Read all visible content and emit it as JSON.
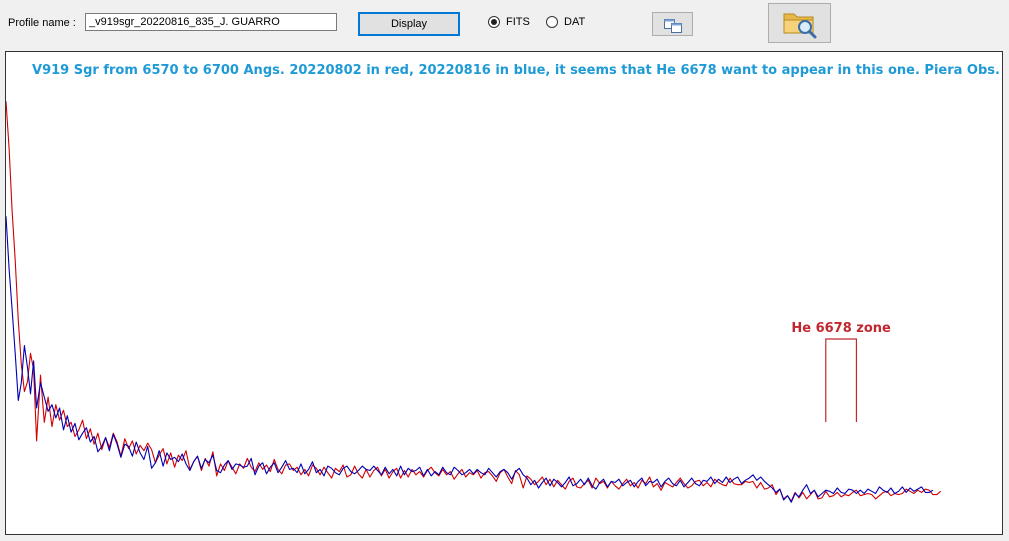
{
  "toolbar": {
    "profile_label": "Profile name :",
    "profile_value": "_v919sgr_20220816_835_J. GUARRO",
    "display_label": "Display",
    "radio_fits": "FITS",
    "radio_dat": "DAT",
    "selected_format": "FITS",
    "copy_icon": "copy-windows-icon",
    "open_icon": "folder-search-icon"
  },
  "colors": {
    "title": "#1e9ad6",
    "annotation": "#c0282e",
    "series_red": "#d10000",
    "series_blue": "#0000b4"
  },
  "chart_data": {
    "type": "line",
    "title": "V919 Sgr from 6570 to 6700 Angs. 20220802 in red, 20220816 in blue, it seems that He 6678 want to appear in this one. Piera Obs.",
    "annotation": {
      "text": "He 6678 zone",
      "x_range": [
        6677,
        6681
      ]
    },
    "xlim": [
      6570,
      6700
    ],
    "ylim": [
      0.6,
      5.0
    ],
    "grid": false,
    "x": [
      6570.0,
      6570.4,
      6570.8,
      6571.2,
      6571.6,
      6572.0,
      6572.4,
      6572.8,
      6573.2,
      6573.6,
      6574.0,
      6574.5,
      6575.0,
      6575.5,
      6576.0,
      6576.5,
      6577.0,
      6577.5,
      6578.0,
      6578.5,
      6579.0,
      6579.5,
      6580.0,
      6580.5,
      6581.0,
      6581.5,
      6582.0,
      6582.5,
      6583.0,
      6583.5,
      6584.0,
      6584.5,
      6585.0,
      6585.5,
      6586.0,
      6586.5,
      6587.0,
      6587.5,
      6588.0,
      6588.5,
      6589.0,
      6589.5,
      6590.0,
      6590.5,
      6591.0,
      6591.5,
      6592.0,
      6592.5,
      6593.0,
      6593.5,
      6594.0,
      6594.5,
      6595.0,
      6595.5,
      6596.0,
      6596.5,
      6597.0,
      6597.5,
      6598.0,
      6598.5,
      6599.0,
      6599.5,
      6600.0,
      6600.5,
      6601.0,
      6601.5,
      6602.0,
      6602.5,
      6603.0,
      6603.5,
      6604.0,
      6604.5,
      6605.0,
      6605.5,
      6606.0,
      6606.5,
      6607.0,
      6607.5,
      6608.0,
      6608.5,
      6609.0,
      6609.5,
      6610.0,
      6610.5,
      6611.0,
      6611.5,
      6612.0,
      6612.5,
      6613.0,
      6613.5,
      6614.0,
      6614.5,
      6615.0,
      6615.5,
      6616.0,
      6616.5,
      6617.0,
      6617.5,
      6618.0,
      6618.5,
      6619.0,
      6619.5,
      6620.0,
      6620.5,
      6621.0,
      6621.5,
      6622.0,
      6622.5,
      6623.0,
      6623.5,
      6624.0,
      6624.5,
      6625.0,
      6625.5,
      6626.0,
      6626.5,
      6627.0,
      6627.5,
      6628.0,
      6628.5,
      6629.0,
      6629.5,
      6630.0,
      6630.5,
      6631.0,
      6631.5,
      6632.0,
      6632.5,
      6633.0,
      6633.5,
      6634.0,
      6634.5,
      6635.0,
      6635.5,
      6636.0,
      6636.5,
      6637.0,
      6637.5,
      6638.0,
      6638.5,
      6639.0,
      6639.5,
      6640.0,
      6640.5,
      6641.0,
      6641.5,
      6642.0,
      6642.5,
      6643.0,
      6643.5,
      6644.0,
      6644.5,
      6645.0,
      6645.5,
      6646.0,
      6646.5,
      6647.0,
      6647.5,
      6648.0,
      6648.5,
      6649.0,
      6649.5,
      6650.0,
      6650.5,
      6651.0,
      6651.5,
      6652.0,
      6652.5,
      6653.0,
      6653.5,
      6654.0,
      6654.5,
      6655.0,
      6655.5,
      6656.0,
      6656.5,
      6657.0,
      6657.5,
      6658.0,
      6658.5,
      6659.0,
      6659.5,
      6660.0,
      6660.5,
      6661.0,
      6661.5,
      6662.0,
      6662.5,
      6663.0,
      6663.5,
      6664.0,
      6664.5,
      6665.0,
      6665.5,
      6666.0,
      6666.5,
      6667.0,
      6667.5,
      6668.0,
      6668.5,
      6669.0,
      6669.5,
      6670.0,
      6670.5,
      6671.0,
      6671.5,
      6672.0,
      6672.5,
      6673.0,
      6673.5,
      6674.0,
      6674.5,
      6675.0,
      6675.5,
      6676.0,
      6676.5,
      6677.0,
      6677.5,
      6678.0,
      6678.5,
      6679.0,
      6679.5,
      6680.0,
      6680.5,
      6681.0,
      6681.5,
      6682.0,
      6682.5,
      6683.0,
      6683.5,
      6684.0,
      6684.5,
      6685.0,
      6685.5,
      6686.0,
      6686.5,
      6687.0,
      6687.5,
      6688.0,
      6688.5,
      6689.0,
      6689.5,
      6690.0,
      6690.5,
      6691.0,
      6691.5,
      6692.0,
      6692.5,
      6693.0,
      6693.5,
      6694.0,
      6694.5,
      6695.0,
      6695.5,
      6696.0,
      6696.5,
      6697.0,
      6697.5,
      6698.0,
      6698.5,
      6699.0,
      6699.5,
      6700.0
    ],
    "series": [
      {
        "color": "red",
        "values": [
          4.55,
          4.12,
          3.55,
          3.1,
          2.55,
          2.15,
          1.9,
          1.99,
          2.25,
          2.1,
          1.45,
          2.05,
          1.62,
          1.85,
          1.58,
          1.78,
          1.64,
          1.73,
          1.58,
          1.62,
          1.49,
          1.55,
          1.64,
          1.47,
          1.56,
          1.42,
          1.52,
          1.37,
          1.48,
          1.39,
          1.52,
          1.44,
          1.31,
          1.47,
          1.38,
          1.45,
          1.33,
          1.41,
          1.36,
          1.43,
          1.37,
          1.25,
          1.32,
          1.38,
          1.24,
          1.34,
          1.21,
          1.32,
          1.27,
          1.36,
          1.19,
          1.26,
          1.31,
          1.18,
          1.29,
          1.22,
          1.35,
          1.13,
          1.24,
          1.18,
          1.27,
          1.21,
          1.15,
          1.24,
          1.2,
          1.29,
          1.21,
          1.17,
          1.25,
          1.19,
          1.23,
          1.17,
          1.28,
          1.19,
          1.15,
          1.23,
          1.24,
          1.18,
          1.21,
          1.14,
          1.19,
          1.13,
          1.23,
          1.2,
          1.14,
          1.21,
          1.16,
          1.11,
          1.2,
          1.17,
          1.23,
          1.12,
          1.14,
          1.22,
          1.15,
          1.11,
          1.19,
          1.12,
          1.18,
          1.21,
          1.13,
          1.19,
          1.11,
          1.17,
          1.2,
          1.11,
          1.18,
          1.12,
          1.19,
          1.14,
          1.17,
          1.12,
          1.18,
          1.21,
          1.16,
          1.13,
          1.19,
          1.14,
          1.17,
          1.1,
          1.15,
          1.19,
          1.12,
          1.16,
          1.14,
          1.18,
          1.11,
          1.16,
          1.17,
          1.13,
          1.08,
          1.16,
          1.19,
          1.12,
          1.06,
          1.18,
          1.14,
          1.02,
          1.13,
          1.1,
          1.05,
          1.08,
          1.12,
          1.05,
          1.1,
          1.03,
          1.09,
          1.05,
          1.01,
          1.08,
          1.11,
          1.03,
          1.02,
          1.06,
          1.09,
          1.02,
          1.11,
          1.06,
          1.08,
          1.02,
          1.08,
          1.04,
          1.01,
          1.06,
          1.1,
          1.04,
          1.07,
          1.02,
          1.09,
          1.06,
          1.12,
          1.03,
          1.06,
          1.0,
          1.07,
          1.05,
          1.03,
          1.07,
          1.11,
          1.06,
          1.02,
          1.04,
          1.08,
          1.09,
          1.04,
          1.07,
          1.03,
          1.1,
          1.07,
          1.05,
          1.04,
          1.11,
          1.06,
          1.05,
          1.05,
          1.08,
          1.07,
          1.08,
          1.02,
          1.07,
          1.01,
          1.02,
          1.05,
          0.96,
          1.01,
          0.92,
          0.95,
          0.9,
          0.98,
          0.93,
          0.98,
          0.92,
          0.96,
          1.0,
          0.92,
          0.93,
          0.99,
          0.94,
          0.95,
          0.98,
          0.94,
          0.96,
          0.95,
          0.98,
          1.0,
          0.95,
          0.96,
          0.97,
          0.96,
          0.92,
          0.95,
          0.98,
          0.99,
          0.95,
          0.97,
          0.96,
          0.97,
          1.01,
          0.99,
          0.97,
          1.0,
          0.98,
          1.01,
          1.0,
          0.96,
          0.96,
          0.99
        ]
      },
      {
        "color": "blue",
        "values": [
          3.5,
          3.02,
          2.65,
          2.25,
          1.82,
          1.98,
          2.32,
          2.12,
          1.88,
          2.18,
          1.75,
          1.98,
          1.85,
          1.72,
          1.78,
          1.66,
          1.75,
          1.55,
          1.68,
          1.53,
          1.61,
          1.46,
          1.52,
          1.57,
          1.44,
          1.49,
          1.35,
          1.4,
          1.48,
          1.36,
          1.51,
          1.42,
          1.3,
          1.42,
          1.4,
          1.31,
          1.44,
          1.34,
          1.28,
          1.4,
          1.2,
          1.25,
          1.36,
          1.22,
          1.34,
          1.28,
          1.3,
          1.26,
          1.33,
          1.24,
          1.18,
          1.26,
          1.31,
          1.2,
          1.28,
          1.25,
          1.32,
          1.18,
          1.16,
          1.23,
          1.27,
          1.19,
          1.24,
          1.23,
          1.21,
          1.22,
          1.29,
          1.14,
          1.22,
          1.25,
          1.15,
          1.21,
          1.25,
          1.16,
          1.21,
          1.27,
          1.19,
          1.2,
          1.16,
          1.24,
          1.15,
          1.19,
          1.26,
          1.16,
          1.19,
          1.13,
          1.22,
          1.2,
          1.16,
          1.14,
          1.2,
          1.22,
          1.17,
          1.15,
          1.18,
          1.22,
          1.19,
          1.18,
          1.22,
          1.18,
          1.14,
          1.21,
          1.15,
          1.19,
          1.13,
          1.22,
          1.14,
          1.2,
          1.17,
          1.18,
          1.21,
          1.13,
          1.19,
          1.13,
          1.17,
          1.14,
          1.21,
          1.16,
          1.14,
          1.21,
          1.18,
          1.14,
          1.16,
          1.19,
          1.15,
          1.19,
          1.16,
          1.14,
          1.2,
          1.16,
          1.12,
          1.17,
          1.19,
          1.16,
          1.1,
          1.17,
          1.2,
          1.14,
          1.11,
          1.05,
          1.09,
          1.02,
          1.07,
          1.11,
          1.04,
          1.1,
          1.07,
          1.03,
          1.07,
          1.12,
          1.04,
          1.06,
          1.1,
          1.05,
          1.11,
          1.04,
          1.01,
          1.07,
          1.1,
          1.03,
          1.08,
          1.07,
          1.1,
          1.04,
          1.07,
          1.09,
          1.03,
          1.08,
          1.11,
          1.04,
          1.08,
          1.07,
          1.1,
          1.03,
          1.08,
          1.11,
          1.06,
          1.04,
          1.09,
          1.03,
          1.07,
          1.11,
          1.06,
          1.04,
          1.09,
          1.08,
          1.12,
          1.06,
          1.1,
          1.07,
          1.12,
          1.07,
          1.1,
          1.12,
          1.06,
          1.09,
          1.11,
          1.14,
          1.09,
          1.12,
          1.08,
          1.05,
          1.02,
          0.98,
          1.01,
          0.91,
          0.95,
          0.89,
          0.97,
          0.94,
          1.0,
          1.05,
          0.97,
          1.0,
          0.94,
          0.97,
          1.0,
          0.99,
          0.97,
          1.02,
          0.98,
          0.97,
          1.01,
          1.0,
          0.97,
          1.0,
          0.97,
          1.01,
          0.99,
          0.97,
          1.03,
          1.0,
          0.98,
          1.02,
          0.97,
          0.99,
          1.03,
          0.98,
          1.02,
          0.99,
          1.01,
          1.03,
          0.98,
          0.98,
          1.0
        ]
      }
    ]
  }
}
